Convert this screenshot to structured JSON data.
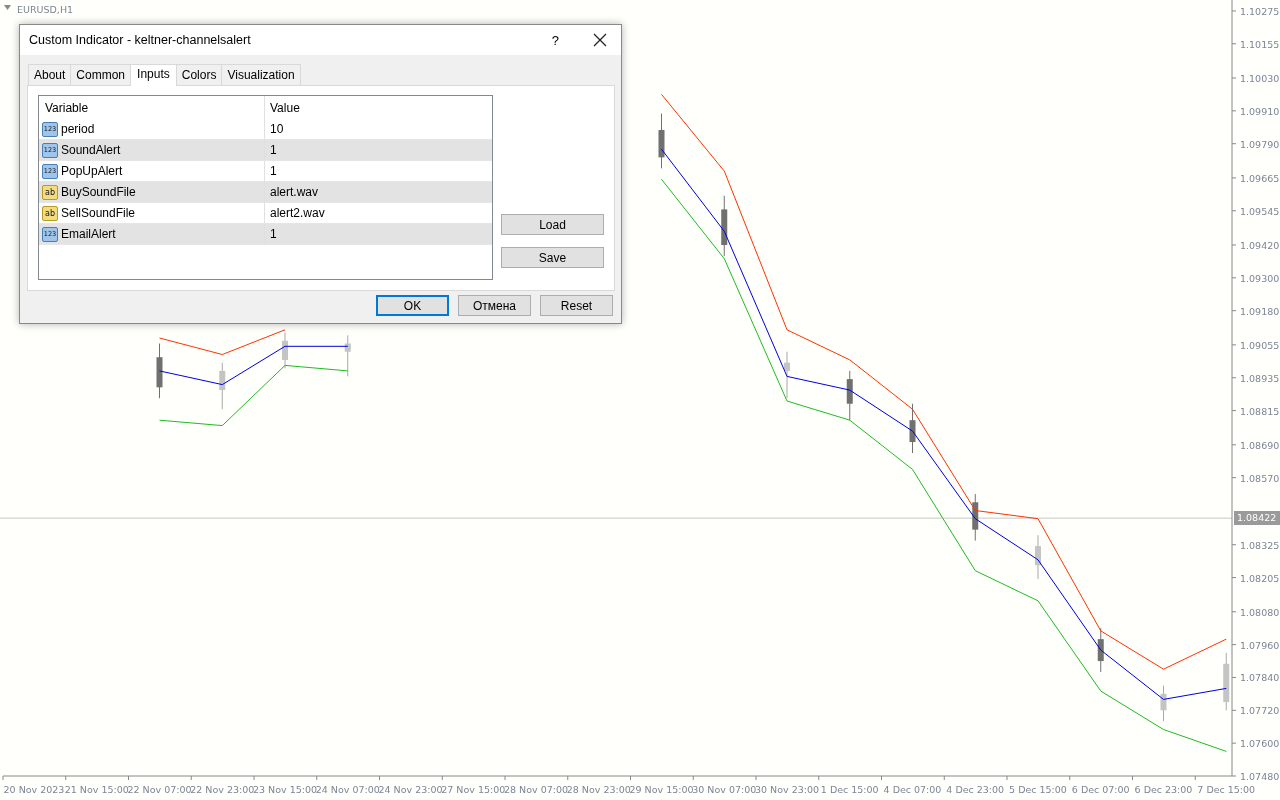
{
  "chart": {
    "symbol": "EURUSD,H1",
    "chart_data": {
      "type": "candlestick",
      "ylim": [
        1.0748,
        1.10315
      ],
      "ref_lines": [
        {
          "axis": "y",
          "value": 1.08422,
          "label": "1.08422"
        }
      ],
      "categories": [
        "20 Nov 2023",
        "21 Nov 15:00",
        "22 Nov 07:00",
        "22 Nov 23:00",
        "23 Nov 15:00",
        "24 Nov 07:00",
        "24 Nov 23:00",
        "27 Nov 15:00",
        "28 Nov 07:00",
        "28 Nov 23:00",
        "29 Nov 15:00",
        "30 Nov 07:00",
        "30 Nov 23:00",
        "1 Dec 15:00",
        "4 Dec 07:00",
        "4 Dec 23:00",
        "5 Dec 15:00",
        "6 Dec 07:00",
        "6 Dec 23:00",
        "7 Dec 15:00"
      ],
      "ohlc": [
        null,
        null,
        [
          1.0901,
          1.0906,
          1.0886,
          1.089
        ],
        [
          1.0889,
          1.0899,
          1.0882,
          1.0896
        ],
        [
          1.09,
          1.091,
          1.0897,
          1.0907
        ],
        [
          1.0903,
          1.0909,
          1.0894,
          1.0906
        ],
        null,
        null,
        null,
        null,
        [
          1.0984,
          1.099,
          1.097,
          1.0974
        ],
        [
          1.0955,
          1.096,
          1.0938,
          1.0942
        ],
        [
          1.0896,
          1.0903,
          1.0886,
          1.0899
        ],
        [
          1.0893,
          1.0896,
          1.0878,
          1.0884
        ],
        [
          1.0878,
          1.0884,
          1.0866,
          1.087
        ],
        [
          1.0848,
          1.0851,
          1.0834,
          1.0838
        ],
        [
          1.0825,
          1.0836,
          1.082,
          1.0832
        ],
        [
          1.0798,
          1.0802,
          1.0786,
          1.079
        ],
        [
          1.0772,
          1.0781,
          1.0768,
          1.0778
        ],
        [
          1.0775,
          1.0793,
          1.0772,
          1.0789
        ]
      ],
      "series": [
        {
          "type": "line",
          "color": "#ff3300",
          "values": [
            null,
            null,
            1.0908,
            1.0902,
            1.0911,
            null,
            null,
            null,
            null,
            null,
            1.0997,
            1.0969,
            1.0911,
            1.09,
            1.0882,
            1.0845,
            1.0842,
            1.0801,
            1.0787,
            1.0798
          ]
        },
        {
          "type": "line",
          "color": "#0000e0",
          "values": [
            null,
            null,
            1.0896,
            1.0891,
            1.0905,
            1.0905,
            null,
            null,
            null,
            null,
            1.0977,
            1.0947,
            1.0894,
            1.0889,
            1.0874,
            1.0842,
            1.0827,
            1.0794,
            1.0776,
            1.078
          ]
        },
        {
          "type": "line",
          "color": "#22bb22",
          "values": [
            null,
            null,
            1.0878,
            1.0876,
            1.0898,
            1.0896,
            null,
            null,
            null,
            null,
            1.0966,
            1.0937,
            1.0885,
            1.0878,
            1.086,
            1.0823,
            1.0812,
            1.0779,
            1.0765,
            1.0757
          ]
        }
      ],
      "yticks": [
        {
          "value": 1.10275,
          "label": "1.10275"
        },
        {
          "value": 1.10155,
          "label": "1.10155"
        },
        {
          "value": 1.1003,
          "label": "1.10030"
        },
        {
          "value": 1.0991,
          "label": "1.09910"
        },
        {
          "value": 1.0979,
          "label": "1.09790"
        },
        {
          "value": 1.09665,
          "label": "1.09665"
        },
        {
          "value": 1.09545,
          "label": "1.09545"
        },
        {
          "value": 1.0942,
          "label": "1.09420"
        },
        {
          "value": 1.093,
          "label": "1.09300"
        },
        {
          "value": 1.0918,
          "label": "1.09180"
        },
        {
          "value": 1.09055,
          "label": "1.09055"
        },
        {
          "value": 1.08935,
          "label": "1.08935"
        },
        {
          "value": 1.08815,
          "label": "1.08815"
        },
        {
          "value": 1.0869,
          "label": "1.08690"
        },
        {
          "value": 1.0857,
          "label": "1.08570"
        },
        {
          "value": 1.08325,
          "label": "1.08325"
        },
        {
          "value": 1.08205,
          "label": "1.08205"
        },
        {
          "value": 1.0808,
          "label": "1.08080"
        },
        {
          "value": 1.0796,
          "label": "1.07960"
        },
        {
          "value": 1.0784,
          "label": "1.07840"
        },
        {
          "value": 1.0772,
          "label": "1.07720"
        },
        {
          "value": 1.076,
          "label": "1.07600"
        },
        {
          "value": 1.0748,
          "label": "1.07480"
        }
      ]
    }
  },
  "dialog": {
    "title": "Custom Indicator - keltner-channelsalert",
    "help": "?",
    "tabs": [
      {
        "label": "About",
        "selected": false
      },
      {
        "label": "Common",
        "selected": false
      },
      {
        "label": "Inputs",
        "selected": true
      },
      {
        "label": "Colors",
        "selected": false
      },
      {
        "label": "Visualization",
        "selected": false
      }
    ],
    "table": {
      "columns": [
        "Variable",
        "Value"
      ],
      "rows": [
        {
          "kind": "number",
          "badge": "123",
          "name": "period",
          "value": "10"
        },
        {
          "kind": "number",
          "badge": "123",
          "name": "SoundAlert",
          "value": "1"
        },
        {
          "kind": "number",
          "badge": "123",
          "name": "PopUpAlert",
          "value": "1"
        },
        {
          "kind": "text",
          "badge": "ab",
          "name": "BuySoundFile",
          "value": "alert.wav"
        },
        {
          "kind": "text",
          "badge": "ab",
          "name": "SellSoundFile",
          "value": "alert2.wav"
        },
        {
          "kind": "number",
          "badge": "123",
          "name": "EmailAlert",
          "value": "1"
        }
      ]
    },
    "side_buttons": [
      "Load",
      "Save"
    ],
    "buttons": [
      {
        "label": "OK",
        "selected": true
      },
      {
        "label": "Отмена",
        "selected": false
      },
      {
        "label": "Reset",
        "selected": false
      }
    ]
  }
}
